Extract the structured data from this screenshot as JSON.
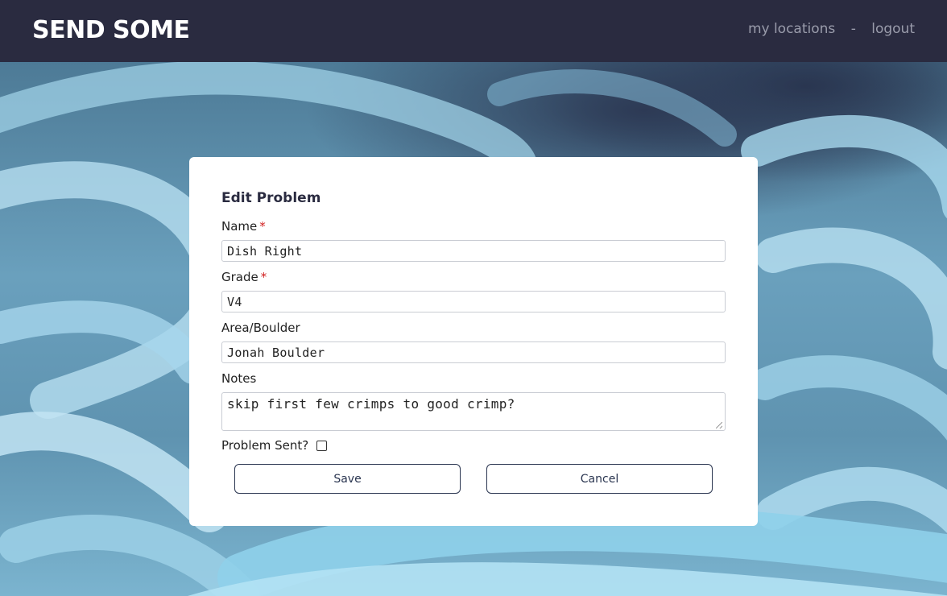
{
  "header": {
    "brand": "SEND SOME",
    "nav": {
      "my_locations": "my locations",
      "separator": "-",
      "logout": "logout"
    }
  },
  "form": {
    "title": "Edit Problem",
    "required_marker": "*",
    "name": {
      "label": "Name",
      "value": "Dish Right"
    },
    "grade": {
      "label": "Grade",
      "value": "V4"
    },
    "area": {
      "label": "Area/Boulder",
      "value": "Jonah Boulder"
    },
    "notes": {
      "label": "Notes",
      "value": "skip first few crimps to good crimp?"
    },
    "sent": {
      "label": "Problem Sent?",
      "checked": false
    },
    "save_label": "Save",
    "cancel_label": "Cancel"
  },
  "colors": {
    "header_bg": "#2a2b40",
    "nav_text": "#9a9cab",
    "required": "#d11f1f",
    "button_border": "#2a3550"
  }
}
